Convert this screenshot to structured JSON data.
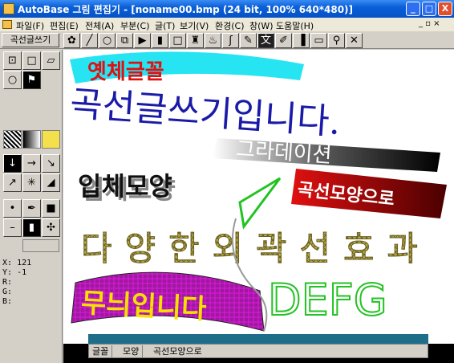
{
  "window": {
    "title": "AutoBase 그림 편집기 - [noname00.bmp (24 bit, 100% 640*480)]",
    "min_label": "_",
    "max_label": "□",
    "close_label": "X"
  },
  "menu": {
    "items": [
      "파일(F)",
      "편집(E)",
      "전체(A)",
      "부분(C)",
      "글(T)",
      "보기(V)",
      "환경(C)",
      "창(W)",
      "도움말(H)"
    ],
    "right_controls": "_ ▫ ×"
  },
  "toolbar": {
    "mode_label": "곡선글쓰기"
  },
  "status": {
    "x_label": "X:",
    "x_value": "121",
    "y_label": "Y:",
    "y_value": "-1",
    "r_label": "R:",
    "g_label": "G:",
    "b_label": "B:"
  },
  "fontbar": {
    "font_label": "글꼴",
    "shape_label": "모양",
    "shape_value": "곡선모양으로"
  },
  "canvas_texts": {
    "t1": "옛체글꼴",
    "t2": "곡선글쓰기입니다.",
    "t3": "그라데이션",
    "t4": "입체모양",
    "t5": "곡선모양으로",
    "t6": "다양한외곽선효과",
    "t7": "무늬입니다",
    "t8": "DEFG"
  },
  "colors": {
    "titlebar": "#0a5fd8",
    "cyan": "#27e4f2",
    "red": "#e01010",
    "navy": "#1a1aa8",
    "green": "#22c322",
    "magenta": "#e414e4",
    "gold": "#b6a94a"
  }
}
